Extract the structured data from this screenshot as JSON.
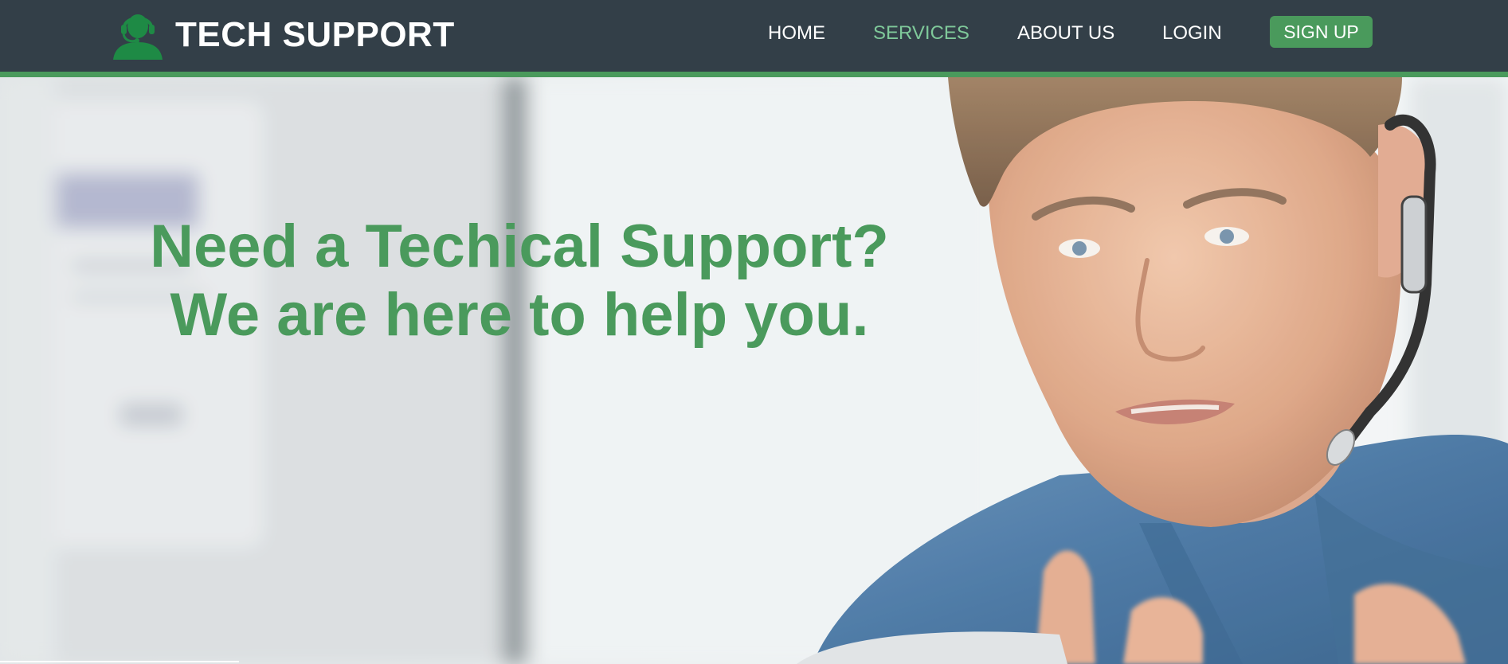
{
  "brand": {
    "title": "TECH SUPPORT",
    "icon": "support-agent-headset-icon",
    "icon_color": "#1e8a45"
  },
  "nav": {
    "items": [
      {
        "label": "HOME",
        "active": false
      },
      {
        "label": "SERVICES",
        "active": true
      },
      {
        "label": "ABOUT US",
        "active": false
      },
      {
        "label": "LOGIN",
        "active": false
      }
    ],
    "signup_label": "SIGN UP"
  },
  "hero": {
    "headline_line1": "Need a Techical Support?",
    "headline_line2": "We are here to help you."
  },
  "colors": {
    "navbar_bg": "#333f48",
    "accent_green": "#4a9a5c",
    "active_link": "#7fc99a",
    "text_light": "#ffffff"
  }
}
